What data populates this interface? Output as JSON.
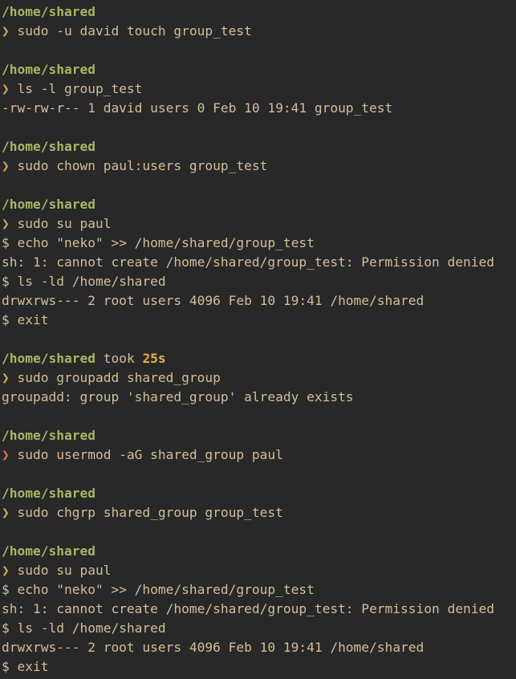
{
  "colors": {
    "background": "#282828",
    "foreground": "#d4be98",
    "path": "#a9b665",
    "prompt_ok": "#d8a657",
    "prompt_err": "#ea6962",
    "duration": "#e9b143"
  },
  "terminal": {
    "lines": [
      {
        "type": "path",
        "text": "/home/shared"
      },
      {
        "type": "prompt",
        "symbol": "❯",
        "status": "ok",
        "cmd": "sudo -u david touch group_test"
      },
      {
        "type": "blank"
      },
      {
        "type": "path",
        "text": "/home/shared"
      },
      {
        "type": "prompt",
        "symbol": "❯",
        "status": "ok",
        "cmd": "ls -l group_test"
      },
      {
        "type": "output",
        "text": "-rw-rw-r-- 1 david users 0 Feb 10 19:41 group_test"
      },
      {
        "type": "blank"
      },
      {
        "type": "path",
        "text": "/home/shared"
      },
      {
        "type": "prompt",
        "symbol": "❯",
        "status": "ok",
        "cmd": "sudo chown paul:users group_test"
      },
      {
        "type": "blank"
      },
      {
        "type": "path",
        "text": "/home/shared"
      },
      {
        "type": "prompt",
        "symbol": "❯",
        "status": "ok",
        "cmd": "sudo su paul"
      },
      {
        "type": "shell",
        "symbol": "$",
        "cmd": "echo \"neko\" >> /home/shared/group_test"
      },
      {
        "type": "output",
        "text": "sh: 1: cannot create /home/shared/group_test: Permission denied"
      },
      {
        "type": "shell",
        "symbol": "$",
        "cmd": "ls -ld /home/shared"
      },
      {
        "type": "output",
        "text": "drwxrws--- 2 root users 4096 Feb 10 19:41 /home/shared"
      },
      {
        "type": "shell",
        "symbol": "$",
        "cmd": "exit"
      },
      {
        "type": "blank"
      },
      {
        "type": "path",
        "text": "/home/shared",
        "took": "took",
        "duration": "25s"
      },
      {
        "type": "prompt",
        "symbol": "❯",
        "status": "ok",
        "cmd": "sudo groupadd shared_group"
      },
      {
        "type": "output",
        "text": "groupadd: group 'shared_group' already exists"
      },
      {
        "type": "blank"
      },
      {
        "type": "path",
        "text": "/home/shared"
      },
      {
        "type": "prompt",
        "symbol": "❯",
        "status": "err",
        "cmd": "sudo usermod -aG shared_group paul"
      },
      {
        "type": "blank"
      },
      {
        "type": "path",
        "text": "/home/shared"
      },
      {
        "type": "prompt",
        "symbol": "❯",
        "status": "ok",
        "cmd": "sudo chgrp shared_group group_test"
      },
      {
        "type": "blank"
      },
      {
        "type": "path",
        "text": "/home/shared"
      },
      {
        "type": "prompt",
        "symbol": "❯",
        "status": "ok",
        "cmd": "sudo su paul"
      },
      {
        "type": "shell",
        "symbol": "$",
        "cmd": "echo \"neko\" >> /home/shared/group_test"
      },
      {
        "type": "output",
        "text": "sh: 1: cannot create /home/shared/group_test: Permission denied"
      },
      {
        "type": "shell",
        "symbol": "$",
        "cmd": "ls -ld /home/shared"
      },
      {
        "type": "output",
        "text": "drwxrws--- 2 root users 4096 Feb 10 19:41 /home/shared"
      },
      {
        "type": "shell",
        "symbol": "$",
        "cmd": "exit"
      }
    ]
  }
}
